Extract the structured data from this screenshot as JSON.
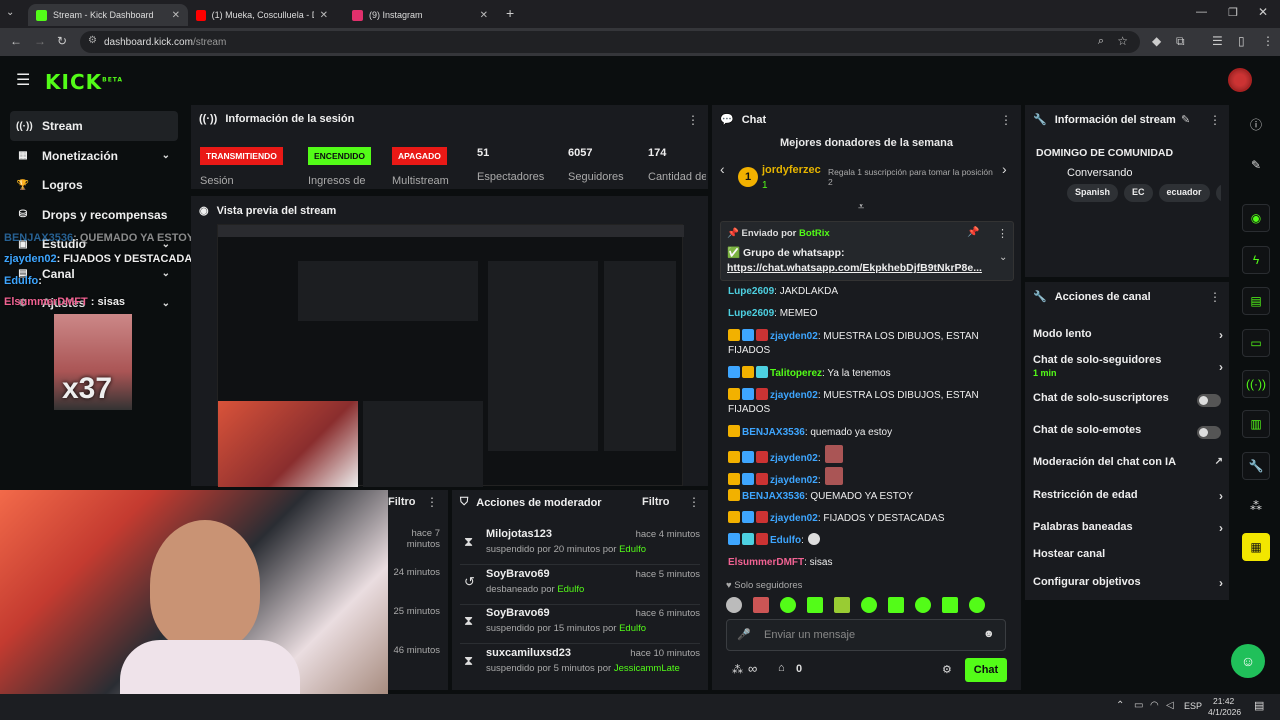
{
  "browser": {
    "tabs": [
      {
        "label": "Stream - Kick Dashboard",
        "active": true,
        "favicon_color": "#53fc18"
      },
      {
        "label": "(1) Mueka, Cosculluela - Di...",
        "active": false,
        "favicon_color": "#ff0000"
      },
      {
        "label": "(9) Instagram",
        "active": false,
        "favicon_color": "#e1306c"
      }
    ],
    "new_tab": "+",
    "url_host": "dashboard.kick.com",
    "url_path": "/stream"
  },
  "kick": {
    "logo": "KICK",
    "logo_sup": "BETA",
    "accent": "#53fc18"
  },
  "sidebar": {
    "items": [
      {
        "label": "Stream",
        "icon": "broadcast-icon",
        "glyph": "((·))",
        "active": true
      },
      {
        "label": "Monetización",
        "icon": "money-icon",
        "glyph": "▦",
        "chev": true
      },
      {
        "label": "Logros",
        "icon": "trophy-icon",
        "glyph": "🏆"
      },
      {
        "label": "Drops y recompensas",
        "icon": "gift-icon",
        "glyph": "⛁"
      },
      {
        "label": "Estudio",
        "icon": "studio-icon",
        "glyph": "▣",
        "chev": true
      },
      {
        "label": "Canal",
        "icon": "channel-icon",
        "glyph": "▤",
        "chev": true
      },
      {
        "label": "Ajustes",
        "icon": "gear-icon",
        "glyph": "⚙",
        "chev": true
      }
    ]
  },
  "overlay": {
    "lines": [
      {
        "user": "BENJAX3536",
        "text": ": QUEMADO YA ESTOY"
      },
      {
        "user": "zjayden02",
        "text": ": FIJADOS Y DESTACADAS"
      },
      {
        "user": "Edulfo",
        "text": ":"
      },
      {
        "user": "ElsummerDMFT",
        "text": " : sisas"
      }
    ],
    "emote_count": "x37"
  },
  "session": {
    "title": "Información de la sesión",
    "badges": [
      {
        "text": "TRANSMITIENDO",
        "label": "Sesión",
        "color": "#e91916",
        "fg": "#ffffff"
      },
      {
        "text": "ENCENDIDO",
        "label": "Ingresos de",
        "color": "#53fc18",
        "fg": "#0b0e0f"
      },
      {
        "text": "APAGADO",
        "label": "Multistream",
        "color": "#e91916",
        "fg": "#ffffff"
      }
    ],
    "stats": [
      {
        "value": "51",
        "label": "Espectadores"
      },
      {
        "value": "6057",
        "label": "Seguidores"
      },
      {
        "value": "174",
        "label": "Cantidad de suscripción"
      }
    ]
  },
  "preview": {
    "title": "Vista previa del stream"
  },
  "mod_panel_left": {
    "filter": "Filtro",
    "times": [
      "hace 7 minutos",
      "24 minutos",
      "25 minutos",
      "46 minutos"
    ]
  },
  "mod_actions": {
    "title": "Acciones de moderador",
    "filter": "Filtro",
    "rows": [
      {
        "icon": "hourglass-icon",
        "glyph": "⧗",
        "name": "Milojotas123",
        "action": "suspendido por 20 minutos por",
        "mod": "Edulfo",
        "time": "hace 4 minutos"
      },
      {
        "icon": "unban-icon",
        "glyph": "↺",
        "name": "SoyBravo69",
        "action": "desbaneado por",
        "mod": "Edulfo",
        "time": "hace 5 minutos"
      },
      {
        "icon": "hourglass-icon",
        "glyph": "⧗",
        "name": "SoyBravo69",
        "action": "suspendido por 15 minutos por",
        "mod": "Edulfo",
        "time": "hace 6 minutos"
      },
      {
        "icon": "hourglass-icon",
        "glyph": "⧗",
        "name": "suxcamiluxsd23",
        "action": "suspendido por 5 minutos por",
        "mod": "JessicammLate",
        "time": "hace 10 minutos"
      }
    ]
  },
  "chat": {
    "title": "Chat",
    "top_donors_title": "Mejores donadores de la semana",
    "top_donor": {
      "rank": "1",
      "name": "jordyferzec",
      "count": "1"
    },
    "gift_prompt": "Regala 1 suscripción para tomar la posición 2",
    "pinned": {
      "sent_by": "Enviado por",
      "bot": "BotRix",
      "title": "Grupo de whatsapp:",
      "link": "https://chat.whatsapp.com/EkpkhebDjfB9tNkrP8e..."
    },
    "messages": [
      {
        "user": "Lupe2609",
        "text": ": JAKDLAKDA",
        "color": "#4dd0e1"
      },
      {
        "user": "Lupe2609",
        "text": ": MEMEO",
        "color": "#4dd0e1"
      },
      {
        "user": "zjayden02",
        "text": ": MUESTRA LOS DIBUJOS, ESTAN FIJADOS",
        "color": "#3ea6ff"
      },
      {
        "user": "Talitoperez",
        "text": ": Ya la tenemos",
        "color": "#53fc18"
      },
      {
        "user": "zjayden02",
        "text": ": MUESTRA LOS DIBUJOS, ESTAN FIJADOS",
        "color": "#3ea6ff"
      },
      {
        "user": "BENJAX3536",
        "text": ": quemado ya estoy",
        "color": "#3ea6ff"
      },
      {
        "user": "zjayden02",
        "text": ":",
        "color": "#3ea6ff"
      },
      {
        "user": "zjayden02",
        "text": ":",
        "color": "#3ea6ff"
      },
      {
        "user": "BENJAX3536",
        "text": ": QUEMADO YA ESTOY",
        "color": "#3ea6ff"
      },
      {
        "user": "zjayden02",
        "text": ": FIJADOS Y DESTACADAS",
        "color": "#3ea6ff"
      },
      {
        "user": "Edulfo",
        "text": ":",
        "color": "#3ea6ff"
      },
      {
        "user": "ElsummerDMFT",
        "text": ": sisas",
        "color": "#f06292"
      }
    ],
    "followers_only": "Solo seguidores",
    "input_placeholder": "Enviar un mensaje",
    "points": "∞",
    "count": "0",
    "send_label": "Chat"
  },
  "stream_info": {
    "title": "Información del stream",
    "stream_title": "DOMINGO DE COMUNIDAD",
    "category": "Conversando",
    "tags": [
      "Spanish",
      "EC",
      "ecuador",
      "ela"
    ]
  },
  "channel_actions": {
    "title": "Acciones de canal",
    "items": [
      {
        "label": "Modo lento",
        "type": "arrow"
      },
      {
        "label": "Chat de solo-seguidores",
        "sub": "1 min",
        "type": "arrow"
      },
      {
        "label": "Chat de solo-suscriptores",
        "type": "toggle"
      },
      {
        "label": "Chat de solo-emotes",
        "type": "toggle"
      },
      {
        "label": "Moderación del chat con IA",
        "type": "external"
      },
      {
        "label": "Restricción de edad",
        "type": "arrow"
      },
      {
        "label": "Palabras baneadas",
        "type": "arrow"
      },
      {
        "label": "Hostear canal",
        "type": "none"
      },
      {
        "label": "Configurar objetivos",
        "type": "arrow"
      }
    ]
  },
  "rail": [
    "info-icon",
    "edit-icon",
    "camera-icon",
    "lightning-icon",
    "list-icon",
    "chat-icon",
    "broadcast-icon",
    "cards-icon",
    "wrench-icon",
    "plug-icon",
    "clapper-icon"
  ],
  "taskbar": {
    "lang": "ESP",
    "time": "21:42",
    "date": "4/1/2026"
  }
}
